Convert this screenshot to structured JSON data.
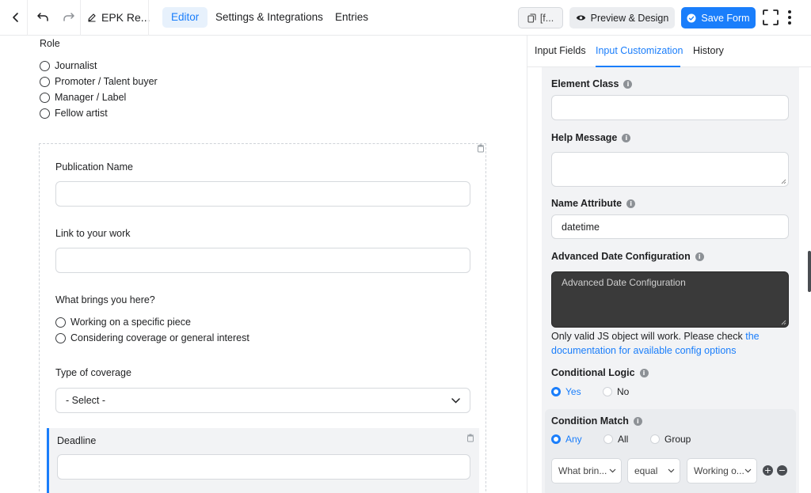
{
  "topbar": {
    "form_name": "EPK Re...",
    "tabs": [
      "Editor",
      "Settings & Integrations",
      "Entries"
    ],
    "shortcode_label": "[f...",
    "preview_label": "Preview & Design",
    "save_label": "Save Form"
  },
  "editor": {
    "role_label": "Role",
    "role_options": [
      "Journalist",
      "Promoter / Talent buyer",
      "Manager / Label",
      "Fellow artist"
    ],
    "publication_label": "Publication Name",
    "link_label": "Link to your work",
    "brings_label": "What brings you here?",
    "brings_options": [
      "Working on a specific piece",
      "Considering coverage or general interest"
    ],
    "coverage_label": "Type of coverage",
    "coverage_select": "- Select -",
    "deadline_label": "Deadline"
  },
  "panel": {
    "tabs": [
      "Input Fields",
      "Input Customization",
      "History"
    ],
    "element_class_label": "Element Class",
    "help_message_label": "Help Message",
    "name_attribute_label": "Name Attribute",
    "name_attribute_value": "datetime",
    "adv_date_label": "Advanced Date Configuration",
    "adv_date_placeholder": "Advanced Date Configuration",
    "note_text": "Only valid JS object will work. Please check ",
    "note_link": "the documentation for available config options",
    "conditional_logic_label": "Conditional Logic",
    "conditional_options": [
      "Yes",
      "No"
    ],
    "condition_match_label": "Condition Match",
    "match_options": [
      "Any",
      "All",
      "Group"
    ],
    "rule_field": "What brin...",
    "rule_operator": "equal",
    "rule_value": "Working o...",
    "add_symbol": "+",
    "remove_symbol": "−"
  },
  "colors": {
    "accent": "#1a7efb",
    "dark_area": "#3a3a3a"
  }
}
